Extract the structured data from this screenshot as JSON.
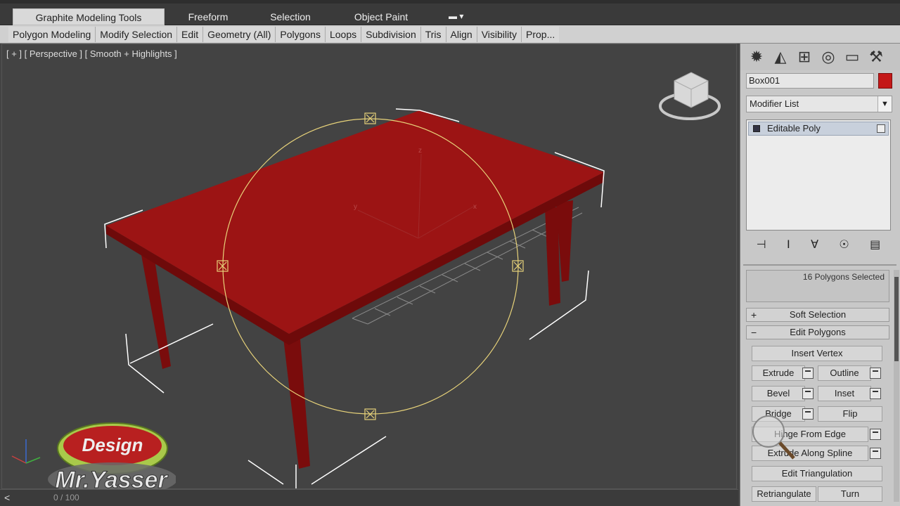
{
  "ribbon": {
    "tabs": [
      "Graphite Modeling Tools",
      "Freeform",
      "Selection",
      "Object Paint"
    ],
    "subitems": [
      "Polygon Modeling",
      "Modify Selection",
      "Edit",
      "Geometry (All)",
      "Polygons",
      "Loops",
      "Subdivision",
      "Tris",
      "Align",
      "Visibility",
      "Prop..."
    ]
  },
  "viewport": {
    "label": "[ + ] [ Perspective ] [ Smooth + Highlights ]",
    "gizmo_axes": [
      "z",
      "y",
      "x"
    ]
  },
  "bottom": {
    "arrow": "<",
    "frame": "0 / 100"
  },
  "panel": {
    "object_name": "Box001",
    "object_color": "#c41818",
    "modifier_list": "Modifier List",
    "stack_item": "Editable Poly",
    "selection_info": "16 Polygons Selected",
    "soft_selection": "Soft Selection",
    "soft_selection_sign": "+",
    "edit_polygons": "Edit Polygons",
    "edit_polygons_sign": "−",
    "buttons": {
      "insert_vertex": "Insert Vertex",
      "extrude": "Extrude",
      "outline": "Outline",
      "bevel": "Bevel",
      "inset": "Inset",
      "bridge": "Bridge",
      "flip": "Flip",
      "hinge": "Hinge From Edge",
      "extrude_spline": "Extrude Along Spline",
      "edit_tri": "Edit Triangulation",
      "retriangulate": "Retriangulate",
      "turn": "Turn"
    }
  },
  "watermark": {
    "line1": "Design",
    "line2": "Mr.Yasser"
  },
  "colors": {
    "table": "#8b1010",
    "table_top": "#9c1414",
    "gizmo": "#e8d37a"
  }
}
